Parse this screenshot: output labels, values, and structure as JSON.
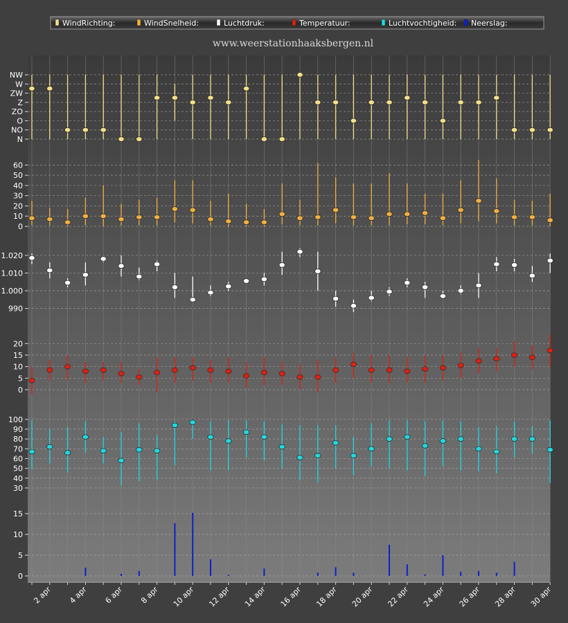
{
  "site": "www.weerstationhaaksbergen.nl",
  "legend": [
    {
      "label": "WindRichting:",
      "color": "#f5e08a"
    },
    {
      "label": "WindSnelheid:",
      "color": "#f2b040"
    },
    {
      "label": "Luchtdruk:",
      "color": "#ffffff"
    },
    {
      "label": "Temperatuur:",
      "color": "#e02010"
    },
    {
      "label": "Luchtvochtigheid:",
      "color": "#20d8e0"
    },
    {
      "label": "Neerslag:",
      "color": "#1020c8"
    }
  ],
  "x_tick_labels": [
    "2 apr",
    "4 apr",
    "6 apr",
    "8 apr",
    "10 apr",
    "12 apr",
    "14 apr",
    "16 apr",
    "18 apr",
    "20 apr",
    "22 apr",
    "24 apr",
    "26 apr",
    "28 apr",
    "30 apr"
  ],
  "chart_data": [
    {
      "type": "scatter",
      "name": "WindRichting",
      "color": "#f5e08a",
      "categories": [
        "N",
        "NO",
        "O",
        "ZO",
        "Z",
        "ZW",
        "W",
        "NW"
      ],
      "yticks": [
        "N",
        "NO",
        "O",
        "ZO",
        "Z",
        "ZW",
        "W",
        "NW"
      ],
      "x": [
        1,
        2,
        3,
        4,
        5,
        6,
        7,
        8,
        9,
        10,
        11,
        12,
        13,
        14,
        15,
        16,
        17,
        18,
        19,
        20,
        21,
        22,
        23,
        24,
        25,
        26,
        27,
        28,
        29,
        30
      ],
      "values": [
        5.5,
        5.5,
        1,
        1,
        1,
        0,
        0,
        4.5,
        4.5,
        4,
        4.5,
        4,
        5.5,
        0,
        0,
        7,
        4,
        4,
        2,
        4,
        4,
        4.5,
        4,
        2,
        4,
        4,
        4.5,
        1,
        1,
        1
      ],
      "low": [
        0,
        0,
        0,
        0,
        0,
        0,
        0,
        0,
        2,
        0,
        0,
        0,
        0,
        0,
        0,
        0,
        0,
        0,
        0,
        0,
        0,
        0,
        0,
        0,
        0,
        0,
        0,
        0,
        0,
        0
      ],
      "high": [
        7,
        7,
        7,
        7,
        7,
        7,
        7,
        7,
        6,
        7,
        7,
        7,
        7,
        7,
        7,
        7,
        7,
        7,
        7,
        7,
        7,
        7,
        7,
        7,
        7,
        7,
        7,
        7,
        7,
        7
      ]
    },
    {
      "type": "scatter",
      "name": "WindSnelheid",
      "color": "#f2b040",
      "ylim": [
        0,
        65
      ],
      "yticks": [
        0,
        10,
        20,
        30,
        40,
        50,
        60
      ],
      "x": [
        1,
        2,
        3,
        4,
        5,
        6,
        7,
        8,
        9,
        10,
        11,
        12,
        13,
        14,
        15,
        16,
        17,
        18,
        19,
        20,
        21,
        22,
        23,
        24,
        25,
        26,
        27,
        28,
        29,
        30
      ],
      "values": [
        8,
        7,
        4,
        10,
        10,
        7,
        9,
        9,
        17,
        16,
        7,
        5,
        4,
        4,
        12,
        8,
        9,
        16,
        9,
        8,
        12,
        12,
        13,
        8,
        16,
        25,
        15,
        9,
        9,
        6
      ],
      "low": [
        1,
        1,
        0,
        1,
        0,
        1,
        1,
        1,
        4,
        3,
        1,
        0,
        0,
        0,
        2,
        1,
        1,
        3,
        1,
        1,
        1,
        2,
        2,
        1,
        3,
        5,
        3,
        1,
        1,
        0
      ],
      "high": [
        25,
        18,
        17,
        28,
        40,
        22,
        26,
        28,
        45,
        45,
        25,
        32,
        22,
        17,
        42,
        26,
        62,
        48,
        42,
        42,
        52,
        42,
        32,
        32,
        45,
        65,
        47,
        26,
        25,
        32
      ]
    },
    {
      "type": "scatter",
      "name": "Luchtdruk",
      "color": "#ffffff",
      "ylim": [
        984,
        1025
      ],
      "yticks": [
        990,
        1000,
        1010,
        1020
      ],
      "ytick_labels": [
        "990",
        "1.000",
        "1.010",
        "1.020"
      ],
      "x": [
        1,
        2,
        3,
        4,
        5,
        6,
        7,
        8,
        9,
        10,
        11,
        12,
        13,
        14,
        15,
        16,
        17,
        18,
        19,
        20,
        21,
        22,
        23,
        24,
        25,
        26,
        27,
        28,
        29,
        30
      ],
      "values": [
        1018.5,
        1011.5,
        1004.5,
        1009,
        1018,
        1014,
        1008,
        1015,
        1002,
        995,
        999,
        1002.5,
        1005.5,
        1006.5,
        1014.5,
        1022,
        1011,
        995.5,
        991.5,
        996,
        999.5,
        1004.5,
        1002,
        997,
        1000,
        1003,
        1015,
        1014.5,
        1008.5,
        1017
      ],
      "low": [
        1015,
        1007,
        1002,
        1003,
        1016,
        1008,
        1006,
        1011,
        996,
        994,
        997,
        1000,
        1004,
        1003,
        1009,
        1019,
        1000,
        991,
        988,
        994,
        997,
        1002,
        996,
        996,
        998,
        996,
        1011,
        1011,
        1005,
        1010
      ],
      "high": [
        1021,
        1016,
        1007,
        1016,
        1019,
        1020,
        1013,
        1017,
        1010,
        1008,
        1003,
        1005,
        1007,
        1010,
        1022,
        1024,
        1022,
        1000,
        995,
        1000,
        1002,
        1007,
        1005,
        1000,
        1003,
        1010,
        1019,
        1018,
        1014,
        1021
      ]
    },
    {
      "type": "scatter",
      "name": "Temperatuur",
      "color": "#e02010",
      "ylim": [
        -6,
        24
      ],
      "yticks": [
        0,
        5,
        10,
        15,
        20
      ],
      "x": [
        1,
        2,
        3,
        4,
        5,
        6,
        7,
        8,
        9,
        10,
        11,
        12,
        13,
        14,
        15,
        16,
        17,
        18,
        19,
        20,
        21,
        22,
        23,
        24,
        25,
        26,
        27,
        28,
        29,
        30
      ],
      "values": [
        4,
        8.5,
        10,
        8,
        8.5,
        7,
        5.5,
        7.5,
        8.5,
        9.5,
        8.5,
        8,
        6,
        7.5,
        7,
        5.5,
        5.5,
        8.5,
        11,
        8.5,
        8.5,
        8,
        9,
        9.5,
        10.5,
        12.5,
        13.5,
        15,
        14,
        17
      ],
      "low": [
        -2,
        4,
        4,
        3,
        4,
        3,
        2,
        -1,
        3,
        4,
        3,
        3,
        1,
        2,
        2,
        0,
        -1,
        3,
        5,
        3,
        3,
        3,
        3,
        4,
        5,
        7,
        8,
        10,
        9,
        10
      ],
      "high": [
        10,
        13,
        15,
        12,
        12,
        12,
        9,
        14,
        14,
        14,
        13,
        14,
        12,
        14,
        12,
        11,
        13,
        14,
        16,
        15,
        15,
        14,
        15,
        15,
        16,
        18,
        18,
        21,
        19,
        24
      ]
    },
    {
      "type": "scatter",
      "name": "Luchtvochtigheid",
      "color": "#20d8e0",
      "ylim": [
        25,
        102
      ],
      "yticks": [
        30,
        40,
        50,
        60,
        70,
        80,
        90,
        100
      ],
      "x": [
        1,
        2,
        3,
        4,
        5,
        6,
        7,
        8,
        9,
        10,
        11,
        12,
        13,
        14,
        15,
        16,
        17,
        18,
        19,
        20,
        21,
        22,
        23,
        24,
        25,
        26,
        27,
        28,
        29,
        30
      ],
      "values": [
        67,
        72,
        66,
        82,
        68,
        58,
        69,
        68,
        94,
        97,
        82,
        78,
        87,
        82,
        72,
        61,
        63,
        76,
        63,
        70,
        80,
        82,
        73,
        78,
        80,
        70,
        67,
        80,
        80,
        69
      ],
      "low": [
        49,
        55,
        46,
        66,
        55,
        32,
        37,
        38,
        53,
        80,
        48,
        48,
        61,
        58,
        50,
        38,
        36,
        50,
        43,
        52,
        50,
        48,
        42,
        52,
        48,
        47,
        45,
        61,
        65,
        35
      ],
      "high": [
        99,
        90,
        92,
        98,
        82,
        87,
        96,
        84,
        98,
        99,
        98,
        99,
        99,
        98,
        95,
        94,
        94,
        94,
        82,
        96,
        99,
        99,
        98,
        99,
        98,
        92,
        93,
        98,
        93,
        99
      ]
    },
    {
      "type": "bar",
      "name": "Neerslag",
      "color": "#1020c8",
      "ylim": [
        -1,
        17
      ],
      "yticks": [
        0,
        5,
        10,
        15
      ],
      "x": [
        1,
        2,
        3,
        4,
        5,
        6,
        7,
        8,
        9,
        10,
        11,
        12,
        13,
        14,
        15,
        16,
        17,
        18,
        19,
        20,
        21,
        22,
        23,
        24,
        25,
        26,
        27,
        28,
        29,
        30
      ],
      "values": [
        0,
        0,
        0,
        2,
        0,
        0.5,
        1.2,
        0,
        12.7,
        15.2,
        4,
        0.3,
        0,
        1.8,
        0,
        0,
        0.8,
        2.1,
        0.8,
        0,
        7.5,
        2.8,
        0.4,
        5,
        1,
        1.2,
        0.8,
        3.4,
        0,
        0
      ]
    }
  ]
}
